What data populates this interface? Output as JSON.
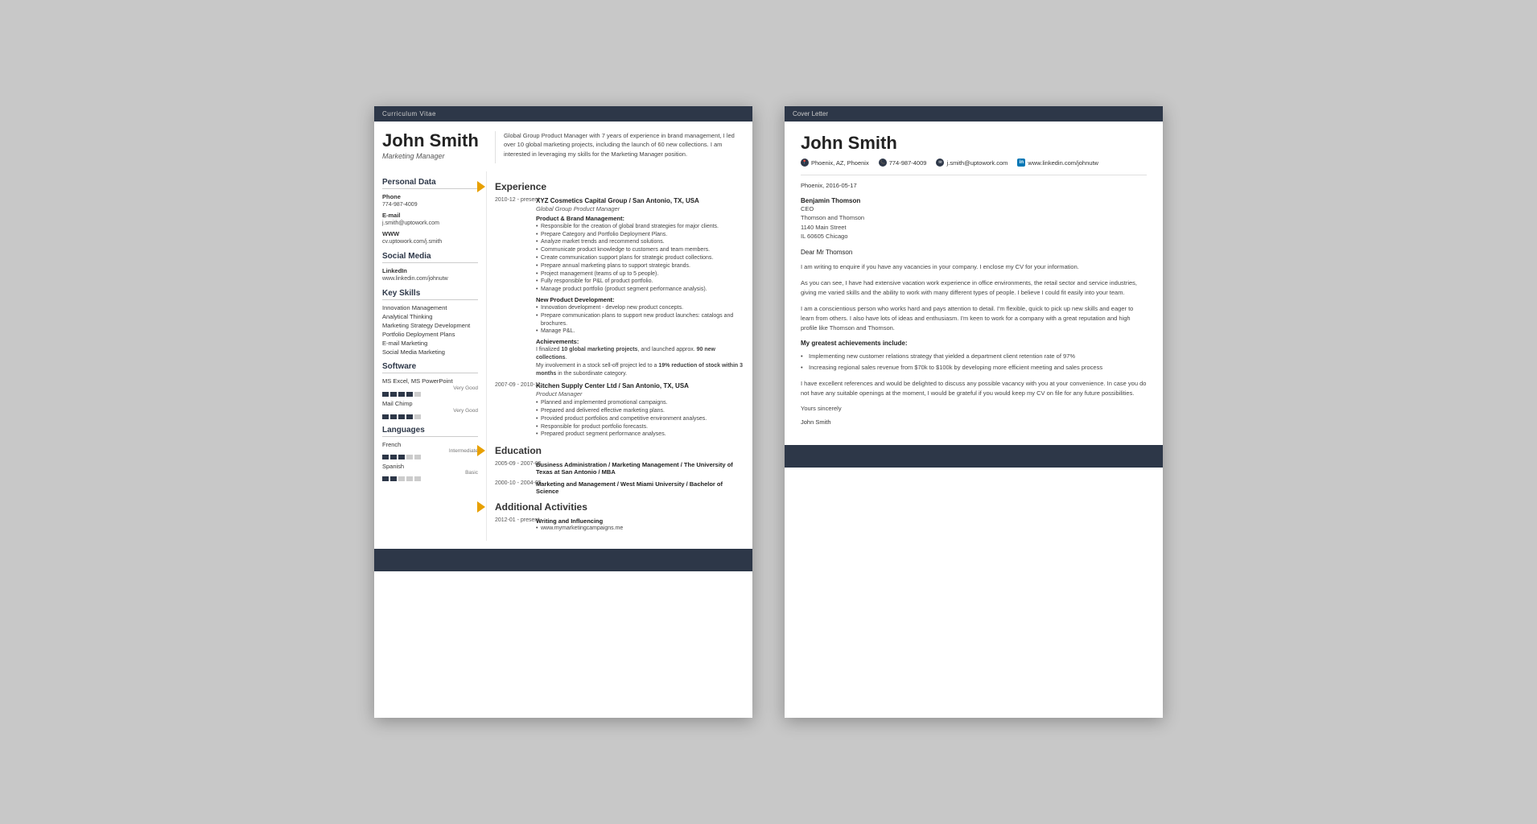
{
  "cv": {
    "header_bar": "Curriculum Vitae",
    "name": "John Smith",
    "title": "Marketing Manager",
    "summary": "Global Group Product Manager with 7 years of experience in brand management, I led over 10 global marketing projects, including the launch of 60 new collections. I am interested in leveraging my skills for the Marketing Manager position.",
    "personal_data": {
      "section": "Personal Data",
      "phone_label": "Phone",
      "phone": "774-987-4009",
      "email_label": "E-mail",
      "email": "j.smith@uptowork.com",
      "www_label": "WWW",
      "www": "cv.uptowork.com/j.smith"
    },
    "social_media": {
      "section": "Social Media",
      "linkedin_label": "LinkedIn",
      "linkedin": "www.linkedin.com/johnutw"
    },
    "key_skills": {
      "section": "Key Skills",
      "items": [
        "Innovation Management",
        "Analytical Thinking",
        "Marketing Strategy Development",
        "Portfolio Deployment Plans",
        "E-mail Marketing",
        "Social Media Marketing"
      ]
    },
    "software": {
      "section": "Software",
      "items": [
        {
          "name": "MS Excel, MS PowerPoint",
          "level": "Very Good",
          "filled": 4,
          "total": 5
        },
        {
          "name": "Mail Chimp",
          "level": "Very Good",
          "filled": 4,
          "total": 5
        }
      ]
    },
    "languages": {
      "section": "Languages",
      "items": [
        {
          "name": "French",
          "level": "Intermediate",
          "filled": 3,
          "total": 5
        },
        {
          "name": "Spanish",
          "level": "Basic",
          "filled": 2,
          "total": 5
        }
      ]
    },
    "experience": {
      "section": "Experience",
      "items": [
        {
          "dates": "2010-12 - present",
          "company": "XYZ Cosmetics Capital Group / San Antonio, TX, USA",
          "role": "Global Group Product Manager",
          "sub_sections": [
            {
              "heading": "Product & Brand Management:",
              "bullets": [
                "Responsible for the creation of global brand strategies for major clients.",
                "Prepare Category and Portfolio Deployment Plans.",
                "Analyze market trends and recommend solutions.",
                "Communicate product knowledge to customers and team members.",
                "Create communication support plans for strategic product collections.",
                "Prepare annual marketing plans to support strategic brands.",
                "Project management (teams of up to 5 people).",
                "Fully responsible for P&L of product portfolio.",
                "Manage product portfolio (product segment performance analysis)."
              ]
            },
            {
              "heading": "New Product Development:",
              "bullets": [
                "Innovation development - develop new product concepts.",
                "Prepare communication plans to support new product launches: catalogs and brochures.",
                "Manage P&L."
              ]
            },
            {
              "heading": "Achievements:",
              "text": "I finalized 10 global marketing projects, and launched approx. 90 new collections.\nMy involvement in a stock sell-off project led to a 19% reduction of stock within 3 months in the subordinate category."
            }
          ]
        },
        {
          "dates": "2007-09 - 2010-11",
          "company": "Kitchen Supply Center Ltd / San Antonio, TX, USA",
          "role": "Product Manager",
          "bullets": [
            "Planned and implemented promotional campaigns.",
            "Prepared and delivered effective marketing plans.",
            "Provided product portfolios and competitive environment analyses.",
            "Responsible for product portfolio forecasts.",
            "Prepared product segment performance analyses."
          ]
        }
      ]
    },
    "education": {
      "section": "Education",
      "items": [
        {
          "dates": "2005-09 - 2007-05",
          "degree": "Business Administration / Marketing Management / The University of Texas at San Antonio / MBA"
        },
        {
          "dates": "2000-10 - 2004-05",
          "degree": "Marketing and Management / West Miami University / Bachelor of Science"
        }
      ]
    },
    "additional": {
      "section": "Additional Activities",
      "items": [
        {
          "dates": "2012-01 - present",
          "title": "Writing and Influencing",
          "detail": "www.mymarketingcampaigns.me"
        }
      ]
    }
  },
  "cover_letter": {
    "header_bar": "Cover Letter",
    "name": "John Smith",
    "contact": {
      "location": "Phoenix, AZ, Phoenix",
      "phone": "774-987-4009",
      "email": "j.smith@uptowork.com",
      "linkedin": "www.linkedin.com/johnutw"
    },
    "date": "Phoenix, 2016-05-17",
    "recipient": {
      "name": "Benjamin Thomson",
      "role": "CEO",
      "company": "Thomson and Thomson",
      "address": "1140 Main Street",
      "city": "IL 60605 Chicago"
    },
    "salutation": "Dear Mr Thomson",
    "paragraphs": [
      "I am writing to enquire if you have any vacancies in your company. I enclose my CV for your information.",
      "As you can see, I have had extensive vacation work experience in office environments, the retail sector and service industries, giving me varied skills and the ability to work with many different types of people. I believe I could fit easily into your team.",
      "I am a conscientious person who works hard and pays attention to detail. I'm flexible, quick to pick up new skills and eager to learn from others. I also have lots of ideas and enthusiasm. I'm keen to work for a company with a great reputation and high profile like Thomson and Thomson."
    ],
    "achievements_title": "My greatest achievements include:",
    "achievements": [
      "Implementing new customer relations strategy that yielded a department client retention rate of 97%",
      "Increasing regional sales revenue from $70k to $100k by developing more efficient meeting and sales process"
    ],
    "closing_paragraph": "I have excellent references and would be delighted to discuss any possible vacancy with you at your convenience. In case you do not have any suitable openings at the moment, I would be grateful if you would keep my CV on file for any future possibilities.",
    "valediction": "Yours sincerely",
    "signature": "John Smith"
  }
}
